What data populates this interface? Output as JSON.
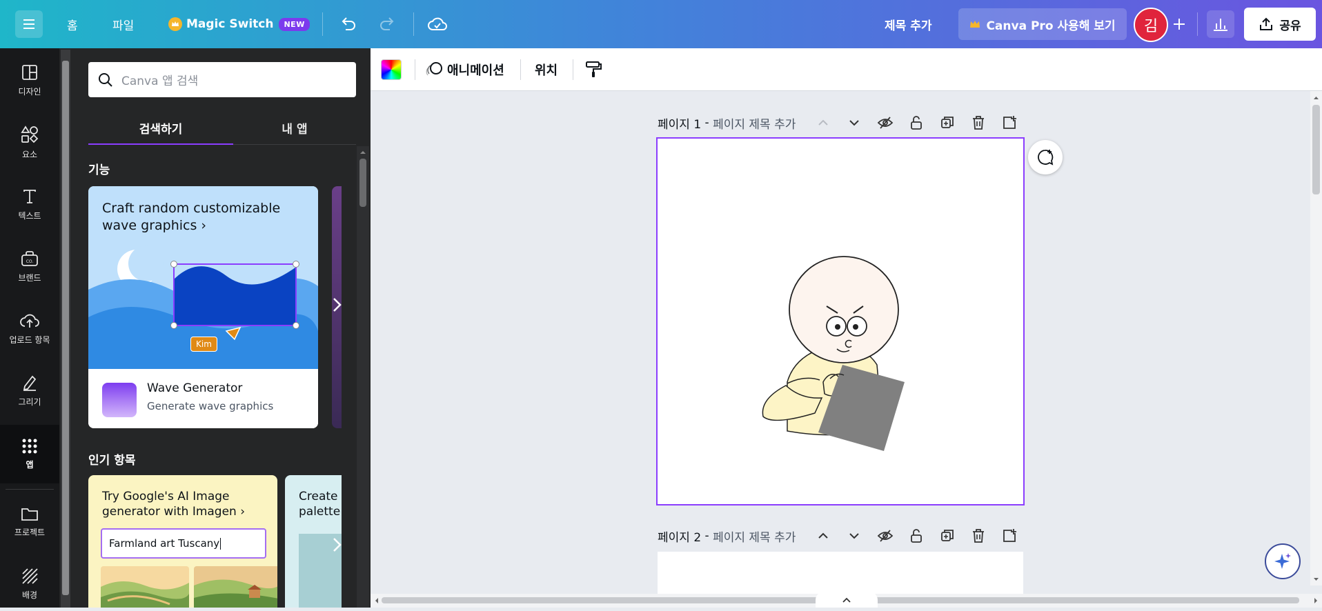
{
  "topbar": {
    "home": "홈",
    "file": "파일",
    "magic_switch": "Magic Switch",
    "new_badge": "NEW",
    "add_title": "제목 추가",
    "pro_button": "Canva Pro 사용해 보기",
    "avatar_initial": "김",
    "share": "공유"
  },
  "rail": {
    "items": [
      {
        "label": "디자인",
        "icon": "layout-icon"
      },
      {
        "label": "요소",
        "icon": "shapes-icon"
      },
      {
        "label": "텍스트",
        "icon": "text-icon"
      },
      {
        "label": "브랜드",
        "icon": "brand-icon"
      },
      {
        "label": "업로드 항목",
        "icon": "upload-cloud-icon"
      },
      {
        "label": "그리기",
        "icon": "pen-icon"
      },
      {
        "label": "앱",
        "icon": "apps-grid-icon"
      },
      {
        "label": "프로젝트",
        "icon": "folder-icon"
      },
      {
        "label": "배경",
        "icon": "background-pattern-icon"
      }
    ]
  },
  "panel": {
    "search_placeholder": "Canva 앱 검색",
    "tab_search": "검색하기",
    "tab_my_apps": "내 앱",
    "section_features": "기능",
    "section_popular": "인기 항목",
    "feature_card": {
      "headline": "Craft random customizable wave graphics ›",
      "cursor_label": "Kim",
      "app_name": "Wave Generator",
      "app_desc": "Generate wave graphics"
    },
    "popular_card": {
      "headline": "Try Google's AI Image generator with Imagen ›",
      "prompt_value": "Farmland art Tuscany"
    },
    "popular_card2": {
      "headline": "Create palette"
    }
  },
  "toolbar": {
    "animation": "애니메이션",
    "position": "위치"
  },
  "pages": [
    {
      "label": "페이지 1",
      "sep": " - ",
      "title_placeholder": "페이지 제목 추가"
    },
    {
      "label": "페이지 2",
      "sep": " - ",
      "title_placeholder": "페이지 제목 추가"
    }
  ],
  "colors": {
    "accent": "#8b3dff",
    "avatar": "#e0243c",
    "rail_bg": "#18191b",
    "panel_bg": "#252627"
  }
}
